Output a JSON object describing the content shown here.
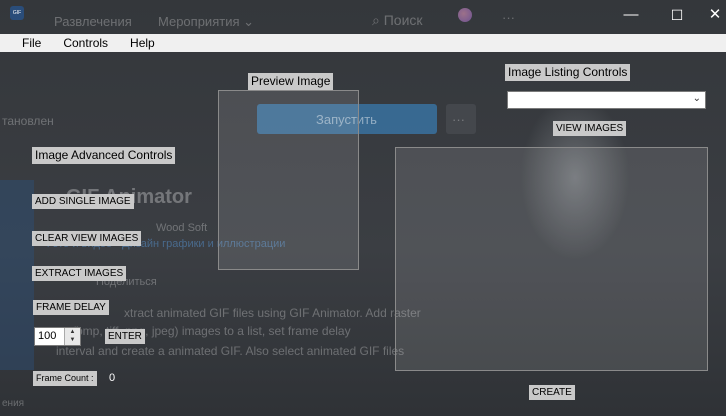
{
  "window": {
    "icon_text": "GIF",
    "minimize": "—",
    "maximize": "☐",
    "close": "✕"
  },
  "menu": [
    "File",
    "Controls",
    "Help"
  ],
  "background": {
    "top_tabs": [
      "Развлечения",
      "Мероприятия ⌄"
    ],
    "search": "Поиск",
    "more": "···",
    "installed": "тановлен",
    "launch": "Запустить",
    "launch_more": "···",
    "app_title": "GIF Animator",
    "publisher": "Wood Soft",
    "categories": "Фото и видео  •  Дизайн графики и иллюстрации",
    "share": "Поделиться",
    "desc_1": "xtract animated GIF files using GIF Animator. Add raster",
    "desc_2": "es (bmp, tiff, png, jpeg) images to a list, set frame delay",
    "desc_3": "interval and create a animated GIF. Also select animated GIF files",
    "footer": "ения"
  },
  "controls": {
    "preview_label": "Preview Image",
    "listing_label": "Image Listing Controls",
    "listing_combo_value": "",
    "view_images": "VIEW IMAGES",
    "advanced_label": "Image Advanced Controls",
    "add_single": "ADD SINGLE IMAGE",
    "clear_view": "CLEAR VIEW IMAGES",
    "extract": "EXTRACT IMAGES",
    "frame_delay_label": "FRAME DELAY",
    "frame_delay_value": "100",
    "enter": "ENTER",
    "frame_count_label": "Frame Count :",
    "frame_count_value": "0",
    "create": "CREATE"
  },
  "icons": {
    "combo_arrow": "chevron-down-icon",
    "spin_up": "spin-up-icon",
    "spin_down": "spin-down-icon"
  }
}
